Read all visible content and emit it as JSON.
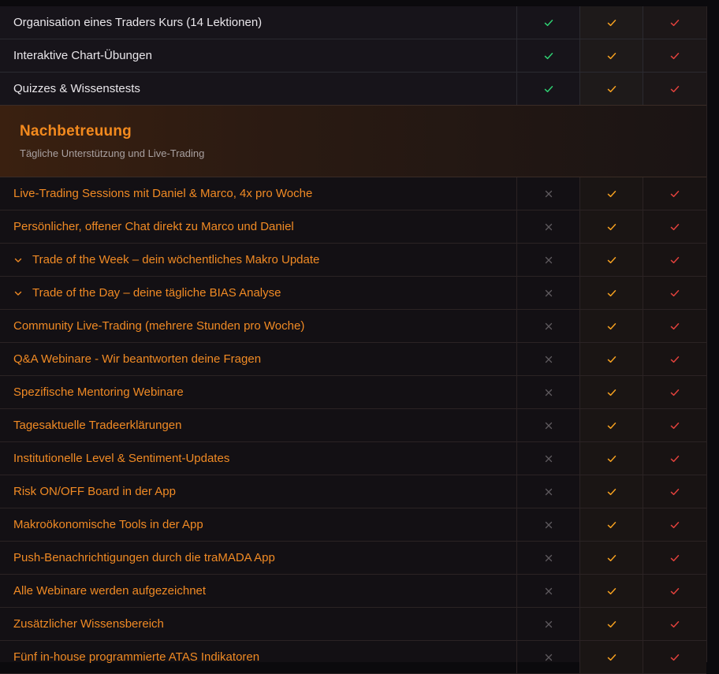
{
  "colors": {
    "accent_orange": "#f08a24",
    "check_green": "#2fcf72",
    "check_orange": "#f5a020",
    "check_red": "#e0413c",
    "cross_gray": "#5e5a5e"
  },
  "top_rows": [
    {
      "label": "Organisation eines Traders Kurs (14 Lektionen)",
      "cols": [
        "check",
        "check",
        "check"
      ]
    },
    {
      "label": "Interaktive Chart-Übungen",
      "cols": [
        "check",
        "check",
        "check"
      ]
    },
    {
      "label": "Quizzes & Wissenstests",
      "cols": [
        "check",
        "check",
        "check"
      ]
    }
  ],
  "section": {
    "title": "Nachbetreuung",
    "subtitle": "Tägliche Unterstützung und Live-Trading"
  },
  "rows": [
    {
      "label": "Live-Trading Sessions mit Daniel & Marco, 4x pro Woche",
      "expandable": false,
      "cols": [
        "cross",
        "check",
        "check"
      ]
    },
    {
      "label": "Persönlicher, offener Chat direkt zu Marco und Daniel",
      "expandable": false,
      "cols": [
        "cross",
        "check",
        "check"
      ]
    },
    {
      "label": "Trade of the Week – dein wöchentliches Makro Update",
      "expandable": true,
      "cols": [
        "cross",
        "check",
        "check"
      ]
    },
    {
      "label": "Trade of the Day – deine tägliche BIAS Analyse",
      "expandable": true,
      "cols": [
        "cross",
        "check",
        "check"
      ]
    },
    {
      "label": "Community Live-Trading (mehrere Stunden pro Woche)",
      "expandable": false,
      "cols": [
        "cross",
        "check",
        "check"
      ]
    },
    {
      "label": "Q&A Webinare - Wir beantworten deine Fragen",
      "expandable": false,
      "cols": [
        "cross",
        "check",
        "check"
      ]
    },
    {
      "label": "Spezifische Mentoring Webinare",
      "expandable": false,
      "cols": [
        "cross",
        "check",
        "check"
      ]
    },
    {
      "label": "Tagesaktuelle Tradeerklärungen",
      "expandable": false,
      "cols": [
        "cross",
        "check",
        "check"
      ]
    },
    {
      "label": "Institutionelle Level & Sentiment-Updates",
      "expandable": false,
      "cols": [
        "cross",
        "check",
        "check"
      ]
    },
    {
      "label": "Risk ON/OFF Board in der App",
      "expandable": false,
      "cols": [
        "cross",
        "check",
        "check"
      ]
    },
    {
      "label": "Makroökonomische Tools in der App",
      "expandable": false,
      "cols": [
        "cross",
        "check",
        "check"
      ]
    },
    {
      "label": "Push-Benachrichtigungen durch die traMADA App",
      "expandable": false,
      "cols": [
        "cross",
        "check",
        "check"
      ]
    },
    {
      "label": "Alle Webinare werden aufgezeichnet",
      "expandable": false,
      "cols": [
        "cross",
        "check",
        "check"
      ]
    },
    {
      "label": "Zusätzlicher Wissensbereich",
      "expandable": false,
      "cols": [
        "cross",
        "check",
        "check"
      ]
    },
    {
      "label": "Fünf in-house programmierte ATAS Indikatoren",
      "expandable": false,
      "cols": [
        "cross",
        "check",
        "check"
      ]
    }
  ]
}
